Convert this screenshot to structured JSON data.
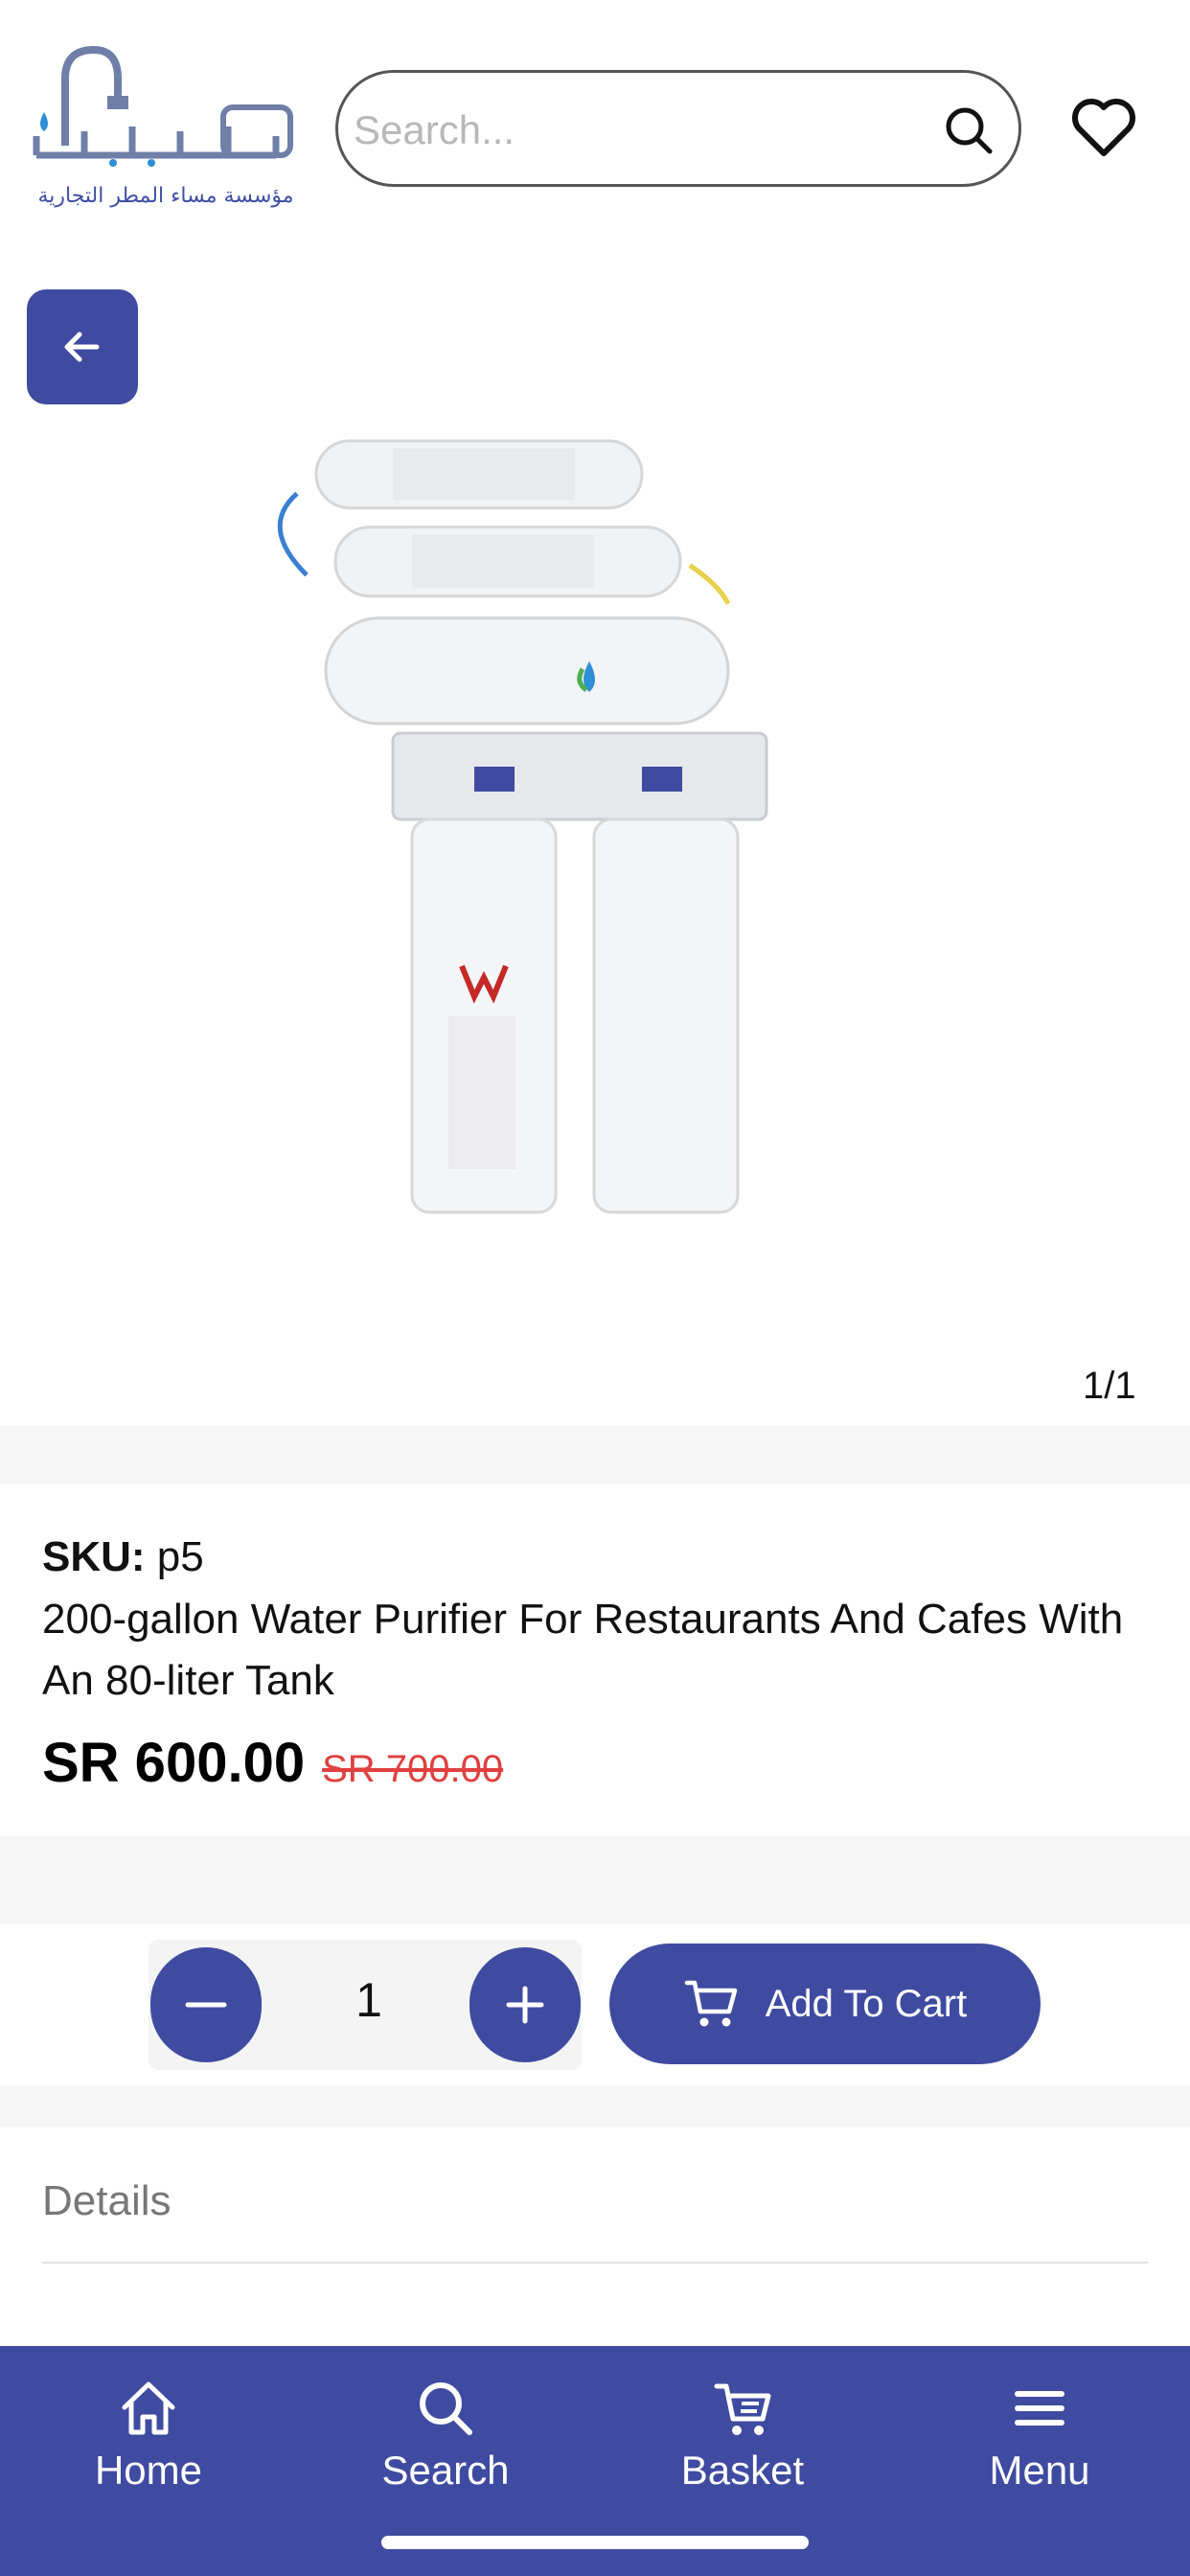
{
  "header": {
    "logo_caption": "مؤسسة مساء المطر التجارية",
    "search_placeholder": "Search..."
  },
  "gallery": {
    "counter": "1/1"
  },
  "product": {
    "sku_label": "SKU:",
    "sku_value": "p5",
    "title": "200-gallon Water Purifier For Restaurants And Cafes With An 80-liter Tank",
    "price": "SR 600.00",
    "old_price": "SR 700.00"
  },
  "cart": {
    "quantity": "1",
    "add_label": "Add To Cart"
  },
  "details": {
    "title": "Details"
  },
  "nav": {
    "items": [
      {
        "label": "Home",
        "icon": "home-icon"
      },
      {
        "label": "Search",
        "icon": "search-icon"
      },
      {
        "label": "Basket",
        "icon": "cart-icon"
      },
      {
        "label": "Menu",
        "icon": "menu-icon"
      }
    ]
  },
  "colors": {
    "primary": "#3f4ba0",
    "sale": "#e04040",
    "band": "#f6f6f6"
  }
}
